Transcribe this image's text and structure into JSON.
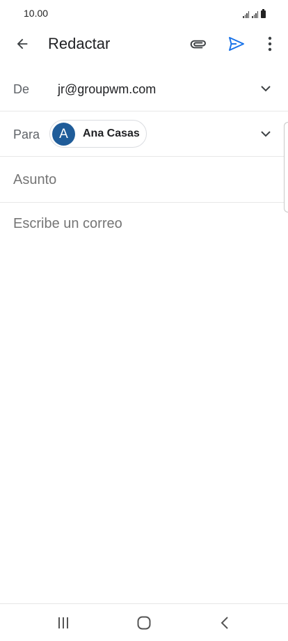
{
  "status_bar": {
    "time": "10.00"
  },
  "toolbar": {
    "title": "Redactar",
    "icons": {
      "back": "arrow-left-icon",
      "attach": "paperclip-icon",
      "send": "send-icon",
      "more": "more-vert-icon"
    },
    "send_color": "#1a73e8"
  },
  "compose": {
    "from_label": "De",
    "from_value": "jr@groupwm.com",
    "to_label": "Para",
    "recipient": {
      "initial": "A",
      "name": "Ana Casas",
      "avatar_color": "#1f5c99"
    },
    "subject_placeholder": "Asunto",
    "body_placeholder": "Escribe un correo"
  },
  "nav_bar": {
    "icons": [
      "recents-icon",
      "home-icon",
      "back-icon"
    ]
  }
}
